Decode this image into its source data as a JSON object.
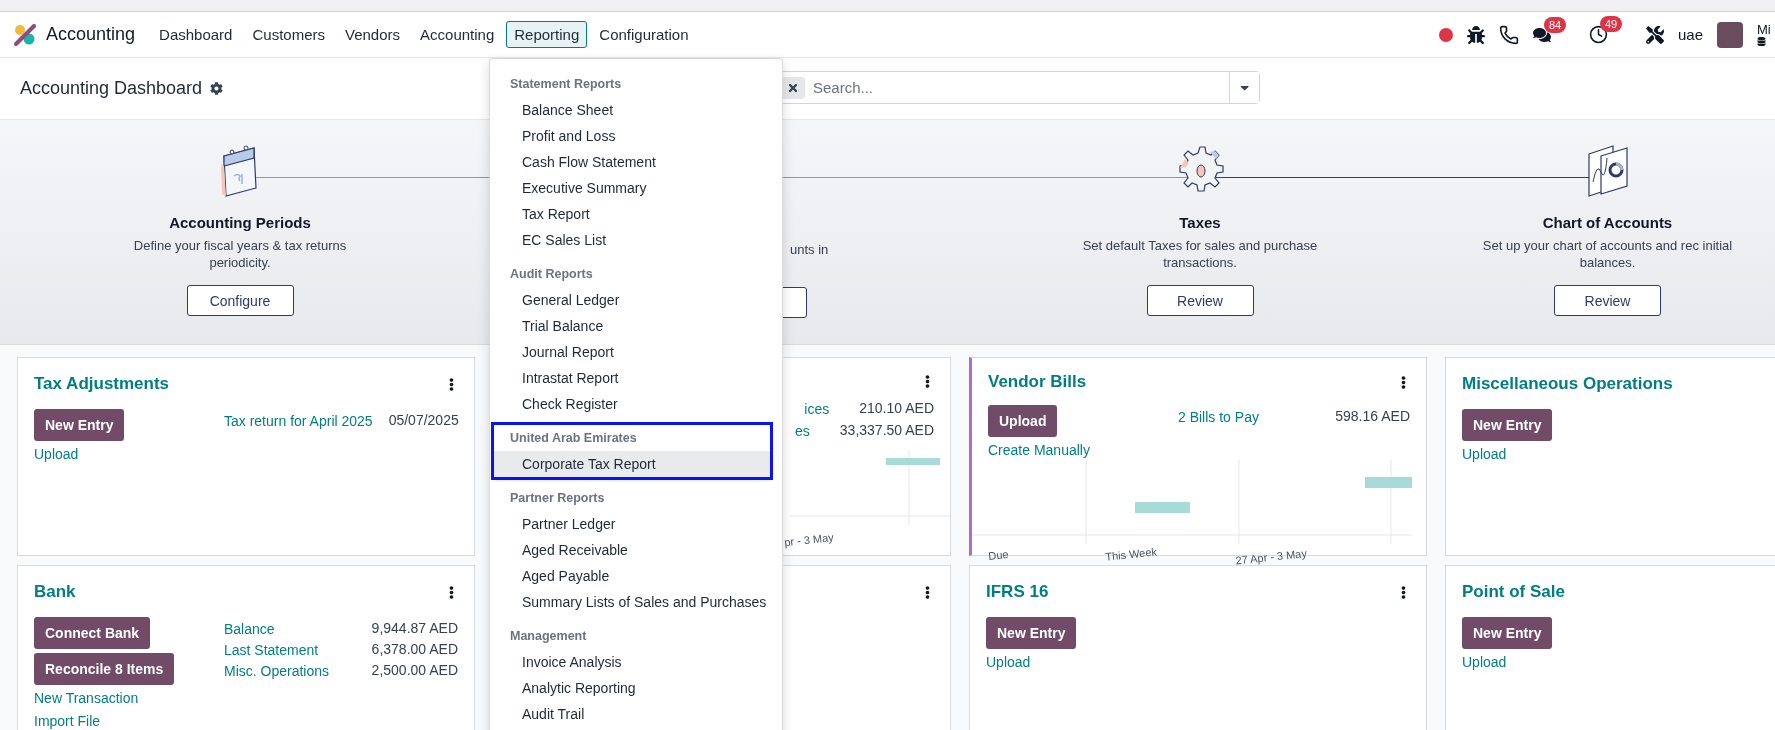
{
  "navbar": {
    "app_name": "Accounting",
    "menu": [
      {
        "label": "Dashboard",
        "selected": false
      },
      {
        "label": "Customers",
        "selected": false
      },
      {
        "label": "Vendors",
        "selected": false
      },
      {
        "label": "Accounting",
        "selected": false
      },
      {
        "label": "Reporting",
        "selected": true
      },
      {
        "label": "Configuration",
        "selected": false
      }
    ],
    "chat_badge": "84",
    "activity_badge": "49",
    "company": "uae",
    "user_name": "Mi"
  },
  "control_panel": {
    "title": "Accounting Dashboard",
    "search": {
      "placeholder": "Search..."
    }
  },
  "onboarding": {
    "steps": [
      {
        "kind": "calendar",
        "title": "Accounting Periods",
        "description": "Define your fiscal years & tax returns periodicity.",
        "button": "Configure"
      },
      {
        "kind": "hidden",
        "description": "unts in"
      },
      {
        "kind": "gear",
        "title": "Taxes",
        "description": "Set default Taxes for sales and purchase transactions.",
        "button": "Review"
      },
      {
        "kind": "chart",
        "title": "Chart of Accounts",
        "description": "Set up your chart of accounts and rec initial balances.",
        "button": "Review"
      }
    ]
  },
  "cards": [
    {
      "kind": "journal",
      "title": "Tax Adjustments",
      "highlighted": false,
      "buttons": [
        "New Entry"
      ],
      "links": [
        "Upload"
      ],
      "summary": [
        {
          "label": "Tax return for April 2025",
          "value": "05/07/2025"
        }
      ]
    },
    {
      "kind": "partial",
      "summary": [
        {
          "label": "ices",
          "value": "210.10 AED"
        },
        {
          "label": "es",
          "value": "33,337.50 AED"
        }
      ],
      "graph_labels": [
        "pr - 3 May"
      ]
    },
    {
      "kind": "journal",
      "title": "Vendor Bills",
      "highlighted": true,
      "buttons": [
        "Upload"
      ],
      "links": [
        "Create Manually"
      ],
      "summary": [
        {
          "label": "2 Bills to Pay",
          "value": "598.16 AED"
        }
      ],
      "graph_labels": [
        "Due",
        "This Week",
        "27 Apr - 3 May"
      ]
    },
    {
      "kind": "journal",
      "title": "Miscellaneous Operations",
      "highlighted": false,
      "buttons": [
        "New Entry"
      ],
      "links": [
        "Upload"
      ]
    },
    {
      "kind": "journal",
      "title": "Bank",
      "highlighted": false,
      "buttons": [
        "Connect Bank",
        "Reconcile 8 Items"
      ],
      "links": [
        "New Transaction",
        "Import File"
      ],
      "summary": [
        {
          "label": "Balance",
          "value": "9,944.87 AED"
        },
        {
          "label": "Last Statement",
          "value": "6,378.00 AED"
        },
        {
          "label": "Misc. Operations",
          "value": "2,500.00 AED"
        }
      ]
    },
    {
      "kind": "partial"
    },
    {
      "kind": "journal",
      "title": "IFRS 16",
      "highlighted": false,
      "buttons": [
        "New Entry"
      ],
      "links": [
        "Upload"
      ]
    },
    {
      "kind": "journal",
      "title": "Point of Sale",
      "highlighted": false,
      "buttons": [
        "New Entry"
      ],
      "links": [
        "Upload"
      ]
    }
  ],
  "reporting_menu": {
    "sections": [
      {
        "heading": "Statement Reports",
        "annotated": false,
        "items": [
          {
            "label": "Balance Sheet",
            "selected": false
          },
          {
            "label": "Profit and Loss",
            "selected": false
          },
          {
            "label": "Cash Flow Statement",
            "selected": false
          },
          {
            "label": "Executive Summary",
            "selected": false
          },
          {
            "label": "Tax Report",
            "selected": false
          },
          {
            "label": "EC Sales List",
            "selected": false
          }
        ]
      },
      {
        "heading": "Audit Reports",
        "annotated": false,
        "items": [
          {
            "label": "General Ledger",
            "selected": false
          },
          {
            "label": "Trial Balance",
            "selected": false
          },
          {
            "label": "Journal Report",
            "selected": false
          },
          {
            "label": "Intrastat Report",
            "selected": false
          },
          {
            "label": "Check Register",
            "selected": false
          }
        ]
      },
      {
        "heading": "United Arab Emirates",
        "annotated": true,
        "items": [
          {
            "label": "Corporate Tax Report",
            "selected": true
          }
        ]
      },
      {
        "heading": "Partner Reports",
        "annotated": false,
        "items": [
          {
            "label": "Partner Ledger",
            "selected": false
          },
          {
            "label": "Aged Receivable",
            "selected": false
          },
          {
            "label": "Aged Payable",
            "selected": false
          },
          {
            "label": "Summary Lists of Sales and Purchases",
            "selected": false
          }
        ]
      },
      {
        "heading": "Management",
        "annotated": false,
        "items": [
          {
            "label": "Invoice Analysis",
            "selected": false
          },
          {
            "label": "Analytic Reporting",
            "selected": false
          },
          {
            "label": "Audit Trail",
            "selected": false
          }
        ]
      }
    ]
  }
}
